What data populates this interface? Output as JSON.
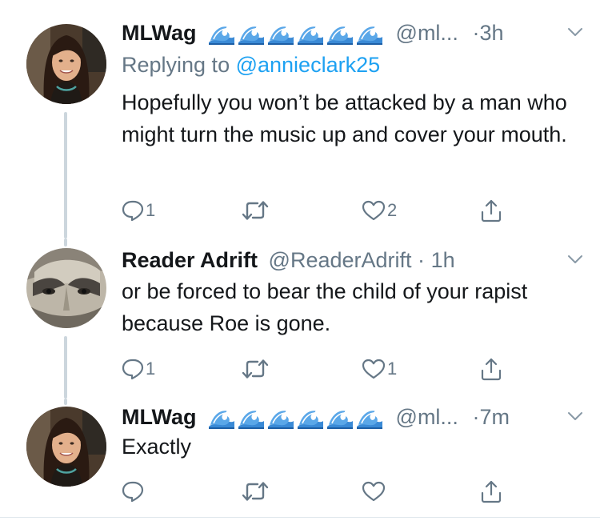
{
  "tweets": [
    {
      "name": "MLWag",
      "handle": "@ml...",
      "dot": "·",
      "time": "3h",
      "replying_prefix": "Replying to ",
      "replying_to": "@annieclark25",
      "text": "Hopefully you won’t be attacked by a man who might turn the music up and cover your mouth.",
      "reply_count": "1",
      "retweet_count": "",
      "like_count": "2",
      "badge_icon": "wave-emoji"
    },
    {
      "name": "Reader Adrift",
      "handle": "@ReaderAdrift",
      "dot": "·",
      "time": "1h",
      "text": "or be forced to bear the child of your rapist because Roe is gone.",
      "reply_count": "1",
      "retweet_count": "",
      "like_count": "1"
    },
    {
      "name": "MLWag",
      "handle": "@ml...",
      "dot": "·",
      "time": "7m",
      "text": "Exactly",
      "reply_count": "",
      "retweet_count": "",
      "like_count": "",
      "badge_icon": "wave-emoji"
    }
  ],
  "colors": {
    "text": "#14171a",
    "secondary": "#657786",
    "link": "#1da1f2",
    "thread_line": "#ccd6dd",
    "divider": "#e1e8ed"
  },
  "icons": [
    "reply-icon",
    "retweet-icon",
    "like-icon",
    "share-icon",
    "chevron-down-icon",
    "wave-emoji"
  ]
}
